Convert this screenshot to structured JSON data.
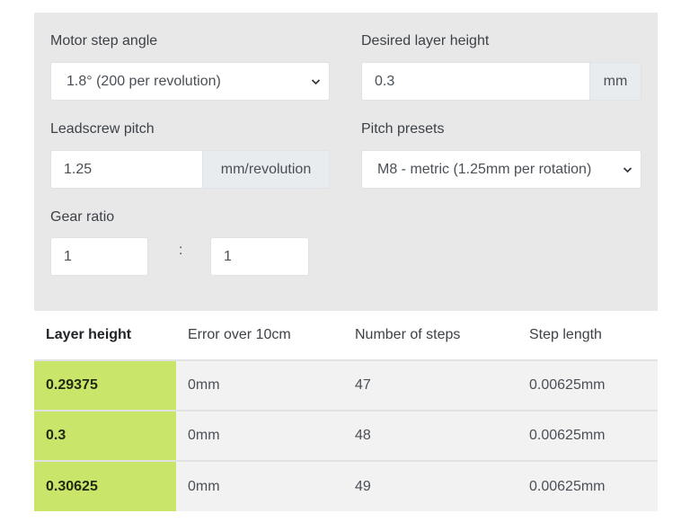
{
  "form": {
    "motor_step_angle": {
      "label": "Motor step angle",
      "selected": "1.8° (200 per revolution)"
    },
    "desired_layer_height": {
      "label": "Desired layer height",
      "value": "0.3",
      "unit": "mm"
    },
    "leadscrew_pitch": {
      "label": "Leadscrew pitch",
      "value": "1.25",
      "unit": "mm/revolution"
    },
    "pitch_presets": {
      "label": "Pitch presets",
      "selected": "M8 - metric (1.25mm per rotation)"
    },
    "gear_ratio": {
      "label": "Gear ratio",
      "left": "1",
      "separator": ":",
      "right": "1"
    }
  },
  "results": {
    "columns": [
      "Layer height",
      "Error over 10cm",
      "Number of steps",
      "Step length"
    ],
    "rows": [
      [
        "0.29375",
        "0mm",
        "47",
        "0.00625mm"
      ],
      [
        "0.3",
        "0mm",
        "48",
        "0.00625mm"
      ],
      [
        "0.30625",
        "0mm",
        "49",
        "0.00625mm"
      ]
    ],
    "highlight_color": "#c9e66b"
  }
}
